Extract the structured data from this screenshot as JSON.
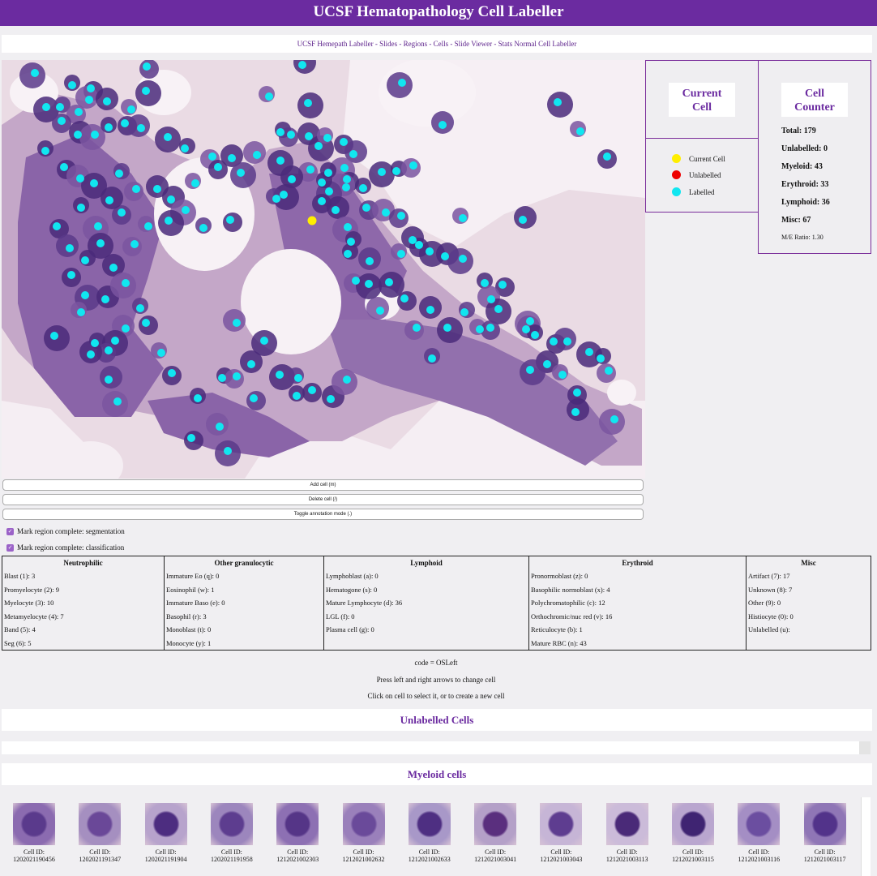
{
  "app": {
    "title": "UCSF Hematopathology Cell Labeller"
  },
  "nav": {
    "links": [
      "UCSF Hemepath Labeller",
      "Slides",
      "Regions",
      "Cells",
      "Slide Viewer",
      "Stats Normal Cell Labeller"
    ],
    "separator": " - "
  },
  "current_cell_panel": {
    "title_line1": "Current",
    "title_line2": "Cell",
    "legend": [
      {
        "label": "Current Cell",
        "color": "#ffee00"
      },
      {
        "label": "Unlabelled",
        "color": "#ee0000"
      },
      {
        "label": "Labelled",
        "color": "#11e6f0"
      }
    ]
  },
  "counter_panel": {
    "title_line1": "Cell",
    "title_line2": "Counter",
    "total": "Total: 179",
    "unlabelled": "Unlabelled: 0",
    "myeloid": "Myeloid: 43",
    "erythroid": "Erythroid: 33",
    "lymphoid": "Lymphoid: 36",
    "misc": "Misc: 67",
    "me_ratio": "M/E Ratio: 1.30"
  },
  "actions": {
    "add_cell": "Add cell (m)",
    "delete_cell": "Delete cell (/)",
    "toggle_mode": "Toggle annotation mode (.)"
  },
  "checkboxes": {
    "segmentation": "Mark region complete: segmentation",
    "classification": "Mark region complete: classification"
  },
  "categories": [
    {
      "head": "Neutrophilic",
      "items": [
        "Blast (1): 3",
        "Promyelocyte (2): 9",
        "Myelocyte (3): 10",
        "Metamyelocyte (4): 7",
        "Band (5): 4",
        "Seg (6): 5"
      ]
    },
    {
      "head": "Other granulocytic",
      "items": [
        "Immature Eo (q): 0",
        "Eosinophil (w): 1",
        "Immature Baso (e): 0",
        "Basophil (r): 3",
        "Monoblast (t): 0",
        "Monocyte (y): 1"
      ]
    },
    {
      "head": "Lymphoid",
      "items": [
        "Lymphoblast (a): 0",
        "Hematogone (s): 0",
        "Mature Lymphocyte (d): 36",
        "LGL (f): 0",
        "Plasma cell (g): 0"
      ]
    },
    {
      "head": "Erythroid",
      "items": [
        "Pronormoblast (z): 0",
        "Basophilic normoblast (x): 4",
        "Polychromatophilic (c): 12",
        "Orthochromic/nuc red (v): 16",
        "Reticulocyte (b): 1",
        "Mature RBC (n): 43"
      ]
    },
    {
      "head": "Misc",
      "items": [
        "Artifact (7): 17",
        "Unknown (8): 7",
        "Other (9): 0",
        "Histiocyte (0): 0",
        "Unlabelled (u):"
      ]
    }
  ],
  "info": {
    "code": "code = OSLeft",
    "arrows_hint": "Press left and right arrows to change cell",
    "click_hint": "Click on cell to select it, or to create a new cell"
  },
  "sections": {
    "unlabelled": "Unlabelled Cells",
    "myeloid": "Myeloid cells"
  },
  "thumbnails": {
    "id_label": "Cell ID:",
    "ids": [
      "1202021190456",
      "1202021191347",
      "1202021191904",
      "1202021191958",
      "1212021002303",
      "1212021002632",
      "1212021002633",
      "1212021003041",
      "1212021003043",
      "1212021003113",
      "1212021003115",
      "1212021003116",
      "1212021003117"
    ]
  }
}
